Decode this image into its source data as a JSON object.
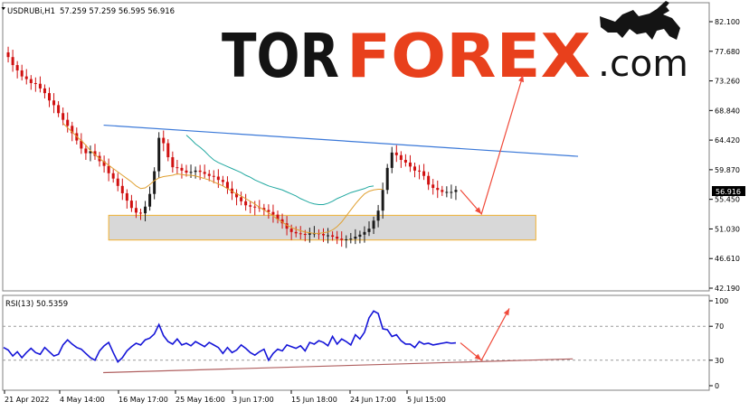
{
  "header": {
    "symbol_tf": "USDRUBi,H1",
    "ohlc": "57.259 57.259 56.595 56.916"
  },
  "watermark": {
    "brand_dark": "TOR",
    "brand_red": "FOREX",
    "brand_suffix": ".com",
    "icon": "bull-icon"
  },
  "colors": {
    "bull_candle": "#1a1a1a",
    "bear_candle": "#d01010",
    "ma_fast": "#e0a030",
    "ma_slow": "#20a8a0",
    "trendline": "#3a78d8",
    "support_zone": "#d8d8d8",
    "support_border": "#f0b030",
    "forecast_arrow": "#f04a3a",
    "rsi_line": "#1515d8",
    "rsi_trend": "#b06060",
    "brand_red": "#e8401c",
    "brand_dark": "#141414"
  },
  "chart_data": [
    {
      "type": "line",
      "title": "USDRUBi,H1",
      "price_label": "56.916",
      "y_ticks": [
        "82.100",
        "77.680",
        "73.260",
        "68.840",
        "64.420",
        "59.870",
        "55.450",
        "51.030",
        "46.610",
        "42.190"
      ],
      "ylim": [
        42.19,
        82.1
      ],
      "x_ticks": [
        "21 Apr 2022",
        "4 May 14:00",
        "16 May 17:00",
        "25 May 16:00",
        "3 Jun 17:00",
        "15 Jun 18:00",
        "24 Jun 17:00",
        "5 Jul 15:00"
      ],
      "x_count": 100,
      "series": [
        {
          "values": [
            77.5,
            76.8,
            75.6,
            74.8,
            73.9,
            73.5,
            72.9,
            72.8,
            72.1,
            71.4,
            70.3,
            69.6,
            68.4,
            67.4,
            66.5,
            65.4,
            64.3,
            63.1,
            62.4,
            62.7,
            62.0,
            61.2,
            60.5,
            59.4,
            58.6,
            57.5,
            56.4,
            55.3,
            54.2,
            53.5,
            53.4,
            54.4,
            56.3,
            59.7,
            64.7,
            63.9,
            61.8,
            60.3,
            60.2,
            59.8,
            59.5,
            59.6,
            59.8,
            59.6,
            59.3,
            59.0,
            58.9,
            58.4,
            58.1,
            57.1,
            56.4,
            55.8,
            55.2,
            54.6,
            54.4,
            54.3,
            54.2,
            53.9,
            53.6,
            53.2,
            52.5,
            51.9,
            51.1,
            50.6,
            50.4,
            50.3,
            50.2,
            50.4,
            50.4,
            50.3,
            50.1,
            50.1,
            49.9,
            49.6,
            49.4,
            49.5,
            49.6,
            49.9,
            50.2,
            50.6,
            51.1,
            52.3,
            53.8,
            56.9,
            60.2,
            62.5,
            62.1,
            61.4,
            61.0,
            60.4,
            59.8,
            59.7,
            59.0,
            57.7,
            57.2,
            56.9,
            56.6,
            56.6,
            56.6,
            56.9
          ]
        },
        {
          "name": "MA fast",
          "values": [
            null,
            null,
            null,
            null,
            null,
            null,
            null,
            null,
            null,
            null,
            null,
            null,
            null,
            66.9,
            66.2,
            65.6,
            64.9,
            64.3,
            63.6,
            62.8,
            62.2,
            61.6,
            61.1,
            60.6,
            60.1,
            59.6,
            59.1,
            58.6,
            58.1,
            57.5,
            57.1,
            57.2,
            57.7,
            58.3,
            58.7,
            58.9,
            59.0,
            59.1,
            59.3,
            59.2,
            59.1,
            59.1,
            59.0,
            58.8,
            58.6,
            58.4,
            58.1,
            57.8,
            57.5,
            57.1,
            56.7,
            56.3,
            56.0,
            55.6,
            55.2,
            54.8,
            54.3,
            53.9,
            53.5,
            53.0,
            52.5,
            52.1,
            51.6,
            51.3,
            51.0,
            50.8,
            50.6,
            50.5,
            50.4,
            50.4,
            50.5,
            50.6,
            50.9,
            51.4,
            52.1,
            53.0,
            53.9,
            54.8,
            55.6,
            56.3,
            56.7,
            56.9,
            57.0,
            57.0
          ]
        },
        {
          "name": "MA slow",
          "values": [
            null,
            null,
            null,
            null,
            null,
            null,
            null,
            null,
            null,
            null,
            null,
            null,
            null,
            null,
            null,
            null,
            null,
            null,
            null,
            null,
            null,
            null,
            null,
            null,
            null,
            null,
            null,
            null,
            null,
            null,
            null,
            null,
            null,
            null,
            null,
            null,
            null,
            null,
            null,
            null,
            65.1,
            64.5,
            63.8,
            63.3,
            62.7,
            62.0,
            61.4,
            61.0,
            60.7,
            60.4,
            60.1,
            59.8,
            59.5,
            59.1,
            58.8,
            58.4,
            58.1,
            57.8,
            57.5,
            57.3,
            57.1,
            56.9,
            56.6,
            56.3,
            56.0,
            55.6,
            55.3,
            55.0,
            54.8,
            54.7,
            54.7,
            54.9,
            55.2,
            55.6,
            55.9,
            56.2,
            56.5,
            56.7,
            56.9,
            57.1,
            57.4,
            57.5
          ]
        }
      ],
      "trendline": {
        "x": [
          21.9,
          100
        ],
        "y": [
          66.6,
          63.1
        ]
      },
      "support_zone": {
        "y": [
          49.4,
          53.1
        ],
        "x": [
          23,
          116.5
        ]
      },
      "forecast": {
        "x": [
          100,
          104.6,
          113.7
        ],
        "y": [
          56.9,
          53.3,
          74.1
        ]
      }
    },
    {
      "type": "line",
      "title": "RSI(13) 50.5359",
      "y_ticks": [
        "100",
        "70",
        "30",
        "0"
      ],
      "ylim": [
        0,
        100
      ],
      "levels": [
        30,
        70
      ],
      "series": [
        {
          "values": [
            45,
            42,
            35,
            40,
            33,
            39,
            44,
            39,
            37,
            45,
            40,
            35,
            37,
            48,
            54,
            49,
            45,
            43,
            38,
            33,
            30,
            41,
            47,
            51,
            39,
            28,
            33,
            41,
            46,
            50,
            48,
            54,
            56,
            61,
            72,
            59,
            52,
            49,
            55,
            48,
            50,
            47,
            52,
            49,
            46,
            51,
            48,
            45,
            38,
            45,
            39,
            42,
            48,
            44,
            39,
            36,
            40,
            43,
            30,
            38,
            43,
            41,
            48,
            46,
            44,
            47,
            41,
            51,
            49,
            53,
            51,
            47,
            58,
            49,
            55,
            52,
            48,
            60,
            55,
            63,
            80,
            88,
            85,
            67,
            66,
            58,
            60,
            53,
            49,
            49,
            45,
            52,
            49,
            50,
            48,
            49,
            50,
            51,
            50,
            50.5
          ]
        }
      ],
      "trendline": {
        "x": [
          21.8,
          124.6
        ],
        "y": [
          15.4,
          31.6
        ]
      },
      "forecast": {
        "x": [
          100,
          104.6,
          110.7
        ],
        "y": [
          50.5,
          30,
          91
        ]
      }
    }
  ]
}
